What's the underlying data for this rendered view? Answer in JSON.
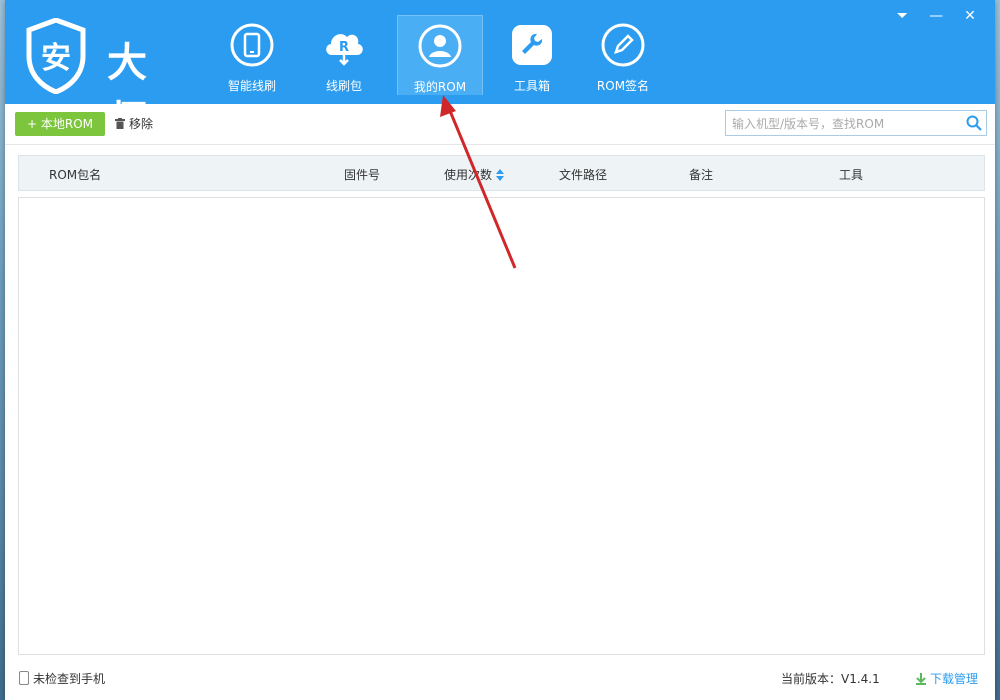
{
  "app": {
    "logo_text": "安大师",
    "accent": "#2b9cf0",
    "window_controls": [
      "menu-icon",
      "minimize-icon",
      "close-icon"
    ]
  },
  "nav": {
    "items": [
      {
        "label": "智能线刷",
        "icon": "phone-refresh-icon",
        "active": false
      },
      {
        "label": "线刷包",
        "icon": "cloud-r-download-icon",
        "active": false
      },
      {
        "label": "我的ROM",
        "icon": "user-icon",
        "active": true
      },
      {
        "label": "工具箱",
        "icon": "wrench-icon",
        "active": false
      },
      {
        "label": "ROM签名",
        "icon": "pen-icon",
        "active": false
      }
    ]
  },
  "toolbar": {
    "add_label": "+ 本地ROM",
    "remove_label": "移除",
    "search_placeholder": "输入机型/版本号，查找ROM",
    "search_value": ""
  },
  "table": {
    "columns": [
      "ROM包名",
      "固件号",
      "使用次数",
      "文件路径",
      "备注",
      "工具"
    ],
    "rows": []
  },
  "status": {
    "phone_status": "未检查到手机",
    "version_label": "当前版本：V1.4.1",
    "download_label": "下载管理"
  }
}
